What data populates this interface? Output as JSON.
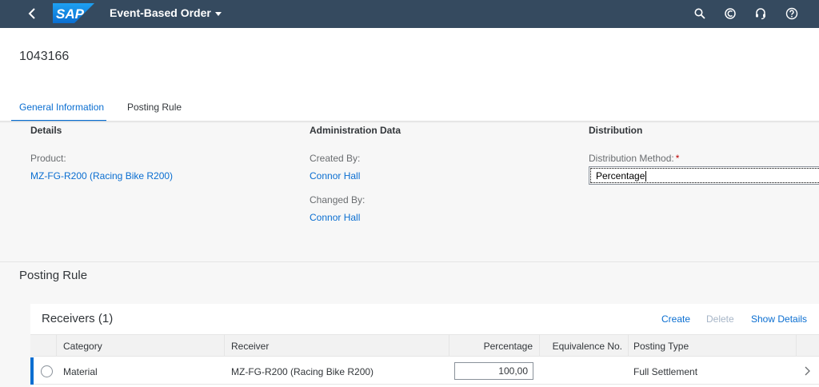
{
  "shell": {
    "logo_text": "SAP",
    "app_title": "Event-Based Order",
    "icons": [
      "back-icon",
      "search-icon",
      "copilot-icon",
      "headset-icon",
      "help-icon"
    ]
  },
  "header": {
    "object_id": "1043166",
    "tabs": [
      {
        "label": "General Information",
        "selected": true
      },
      {
        "label": "Posting Rule",
        "selected": false
      }
    ]
  },
  "details": {
    "heading": "Details",
    "product_label": "Product:",
    "product_value": "MZ-FG-R200 (Racing Bike R200)"
  },
  "admin": {
    "heading": "Administration Data",
    "created_by_label": "Created By:",
    "created_by_value": "Connor Hall",
    "changed_by_label": "Changed By:",
    "changed_by_value": "Connor Hall"
  },
  "distribution": {
    "heading": "Distribution",
    "method_label": "Distribution Method:",
    "required_marker": "*",
    "method_value": "Percentage"
  },
  "posting_rule": {
    "section_title": "Posting Rule",
    "table_title": "Receivers (1)",
    "actions": {
      "create": "Create",
      "delete": "Delete",
      "show_details": "Show Details"
    },
    "columns": [
      "Category",
      "Receiver",
      "Percentage",
      "Equivalence No.",
      "Posting Type"
    ],
    "rows": [
      {
        "category": "Material",
        "receiver": "MZ-FG-R200 (Racing Bike R200)",
        "percentage": "100,00",
        "equivalence_no": "",
        "posting_type": "Full Settlement"
      }
    ]
  },
  "colors": {
    "shell_bg": "#354a5f",
    "link": "#0a6ed1",
    "required": "#bb0000"
  }
}
